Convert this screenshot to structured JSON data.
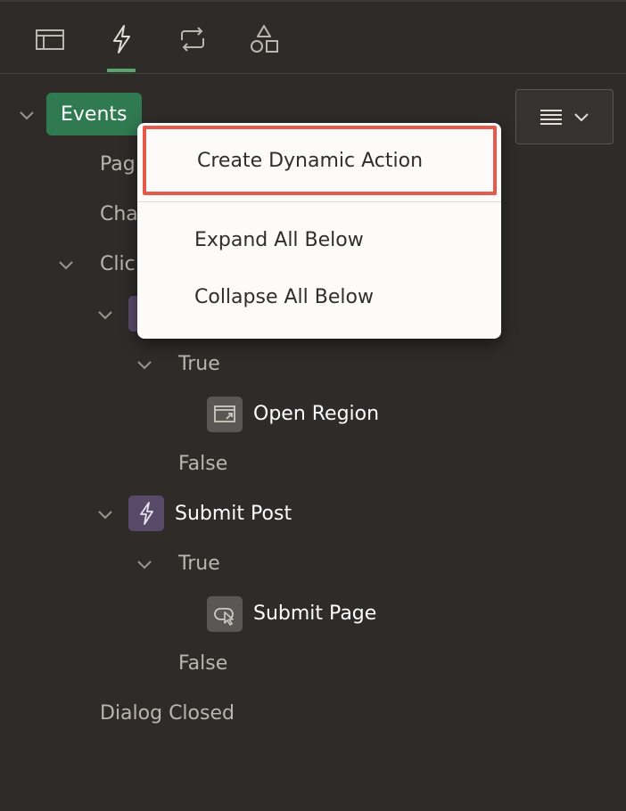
{
  "toolbar": {
    "tabs": [
      {
        "icon": "layout-icon",
        "active": false
      },
      {
        "icon": "lightning-icon",
        "active": true
      },
      {
        "icon": "process-icon",
        "active": false
      },
      {
        "icon": "shapes-icon",
        "active": false
      }
    ]
  },
  "tree": {
    "root_label": "Events",
    "items": {
      "page": "Pag",
      "change": "Cha",
      "click": "Clic",
      "true_1": "True",
      "open_region": "Open Region",
      "false_1": "False",
      "submit_post": "Submit Post",
      "true_2": "True",
      "submit_page": "Submit Page",
      "false_2": "False",
      "dialog_closed": "Dialog Closed"
    }
  },
  "menu_button": {
    "icon": "menu-icon"
  },
  "context_menu": {
    "items": [
      {
        "label": "Create Dynamic Action",
        "focused": true
      },
      {
        "label": "Expand All Below"
      },
      {
        "label": "Collapse All Below"
      }
    ],
    "focus_color": "#e65a4b"
  },
  "colors": {
    "background": "#2e2b29",
    "events_badge": "#2f7a51",
    "active_tab": "#5aa36d",
    "dynamic_action_icon_bg": "#5a4a6a"
  }
}
